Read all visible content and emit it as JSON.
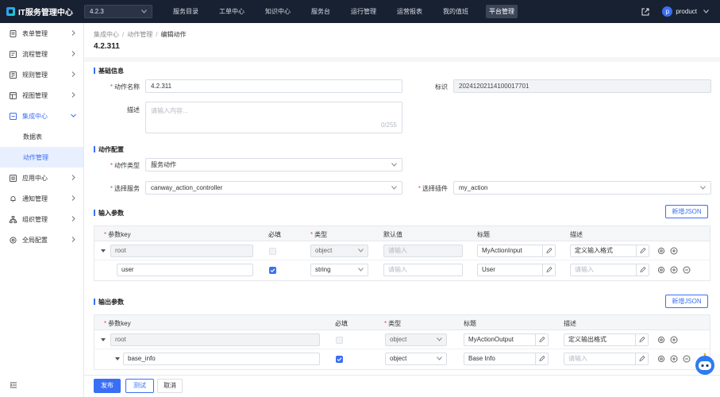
{
  "app": {
    "title": "IT服务管理中心",
    "version": "4.2.3"
  },
  "nav": [
    "服务目录",
    "工单中心",
    "知识中心",
    "服务台",
    "运行管理",
    "运营报表",
    "我的值班",
    "平台管理"
  ],
  "user": {
    "avatar_letter": "p",
    "name": "product"
  },
  "sidebar": {
    "items": [
      {
        "label": "表单管理"
      },
      {
        "label": "流程管理"
      },
      {
        "label": "规则管理"
      },
      {
        "label": "视图管理"
      },
      {
        "label": "集成中心"
      },
      {
        "label": "应用中心"
      },
      {
        "label": "通知管理"
      },
      {
        "label": "组织管理"
      },
      {
        "label": "全局配置"
      }
    ],
    "sub_items": [
      {
        "label": "数据表"
      },
      {
        "label": "动作管理"
      }
    ]
  },
  "breadcrumb": {
    "items": [
      "集成中心",
      "动作管理",
      "编辑动作"
    ],
    "sep": "/"
  },
  "page_title": "4.2.311",
  "basic": {
    "title": "基础信息",
    "name_label": "动作名称",
    "name_value": "4.2.311",
    "id_label": "标识",
    "id_value": "20241202114100017701",
    "desc_label": "描述",
    "desc_placeholder": "请输入内容...",
    "desc_count": "0/255"
  },
  "config": {
    "title": "动作配置",
    "type_label": "动作类型",
    "type_value": "服务动作",
    "service_label": "选择服务",
    "service_value": "canway_action_controller",
    "plugin_label": "选择插件",
    "plugin_value": "my_action"
  },
  "input_params": {
    "title": "输入参数",
    "add_json": "新增JSON",
    "headers": [
      "参数key",
      "必填",
      "类型",
      "默认值",
      "标题",
      "描述"
    ],
    "rows": [
      {
        "key": "root",
        "type": "object",
        "default": "请输入",
        "title": "MyActionInput",
        "desc": "定义输入格式"
      },
      {
        "key": "user",
        "type": "string",
        "default": "请输入",
        "title": "User",
        "desc": "请输入"
      }
    ]
  },
  "output_params": {
    "title": "输出参数",
    "add_json": "新增JSON",
    "headers": [
      "参数key",
      "必填",
      "类型",
      "标题",
      "描述"
    ],
    "rows": [
      {
        "key": "root",
        "type": "object",
        "title": "MyActionOutput",
        "desc": "定义输出格式"
      },
      {
        "key": "base_info",
        "type": "object",
        "title": "Base Info",
        "desc": "请输入"
      }
    ]
  },
  "footer": {
    "publish": "发布",
    "test": "测试",
    "cancel": "取消"
  },
  "colors": {
    "primary": "#3a6ff5",
    "topbar": "#182132",
    "required": "#e5484d"
  }
}
